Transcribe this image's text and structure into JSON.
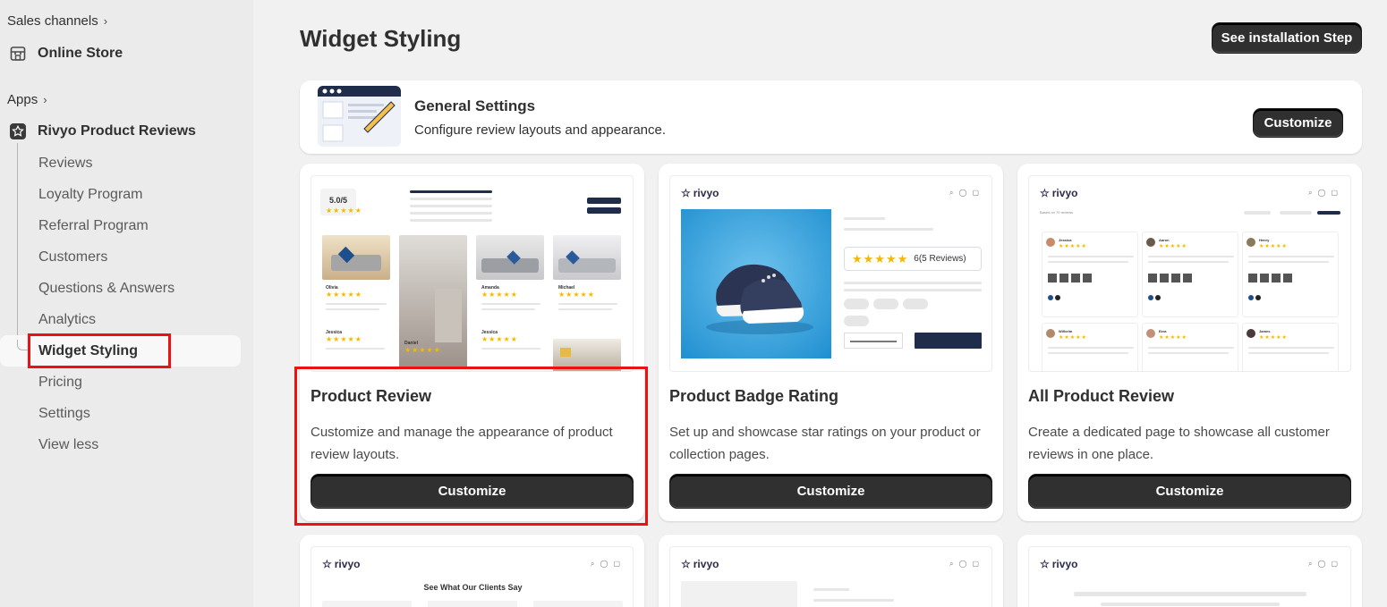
{
  "sidebar": {
    "sales_channels": "Sales channels",
    "online_store": "Online Store",
    "apps": "Apps",
    "app_name": "Rivyo Product Reviews",
    "items": [
      {
        "label": "Reviews"
      },
      {
        "label": "Loyalty Program"
      },
      {
        "label": "Referral Program"
      },
      {
        "label": "Customers"
      },
      {
        "label": "Questions & Answers"
      },
      {
        "label": "Analytics"
      },
      {
        "label": "Widget Styling"
      },
      {
        "label": "Pricing"
      },
      {
        "label": "Settings"
      },
      {
        "label": "View less"
      }
    ]
  },
  "header": {
    "title": "Widget Styling",
    "install_button": "See installation Step"
  },
  "general_settings": {
    "title": "General Settings",
    "description": "Configure review layouts and appearance.",
    "button": "Customize"
  },
  "cards": [
    {
      "title": "Product Review",
      "description": "Customize and manage the appearance of product review layouts.",
      "button": "Customize",
      "preview": {
        "rating": "5.0/5",
        "names": [
          "Olivia",
          "Amanda",
          "Michael",
          "Jessica",
          "Daniel",
          "Jessica"
        ]
      }
    },
    {
      "title": "Product Badge Rating",
      "description": "Set up and showcase star ratings on your product or collection pages.",
      "button": "Customize",
      "preview": {
        "brand": "rivyo",
        "reviews_badge": "6(5 Reviews)"
      }
    },
    {
      "title": "All Product Review",
      "description": "Create a dedicated page to showcase all customer reviews in one place.",
      "button": "Customize",
      "preview": {
        "brand": "rivyo",
        "summary": "Based on 79 reviews",
        "names": [
          "Jessica",
          "Aaron",
          "Henry",
          "Wilhelm",
          "Ezra",
          "James"
        ]
      }
    }
  ],
  "bottom_cards": [
    {
      "brand": "rivyo",
      "heading": "See What Our Clients Say"
    },
    {
      "brand": "rivyo"
    },
    {
      "brand": "rivyo"
    }
  ],
  "colors": {
    "accent_dark": "#303030",
    "highlight_red": "#ee1111",
    "star_yellow": "#f5b800",
    "navy": "#1f2d4a"
  }
}
